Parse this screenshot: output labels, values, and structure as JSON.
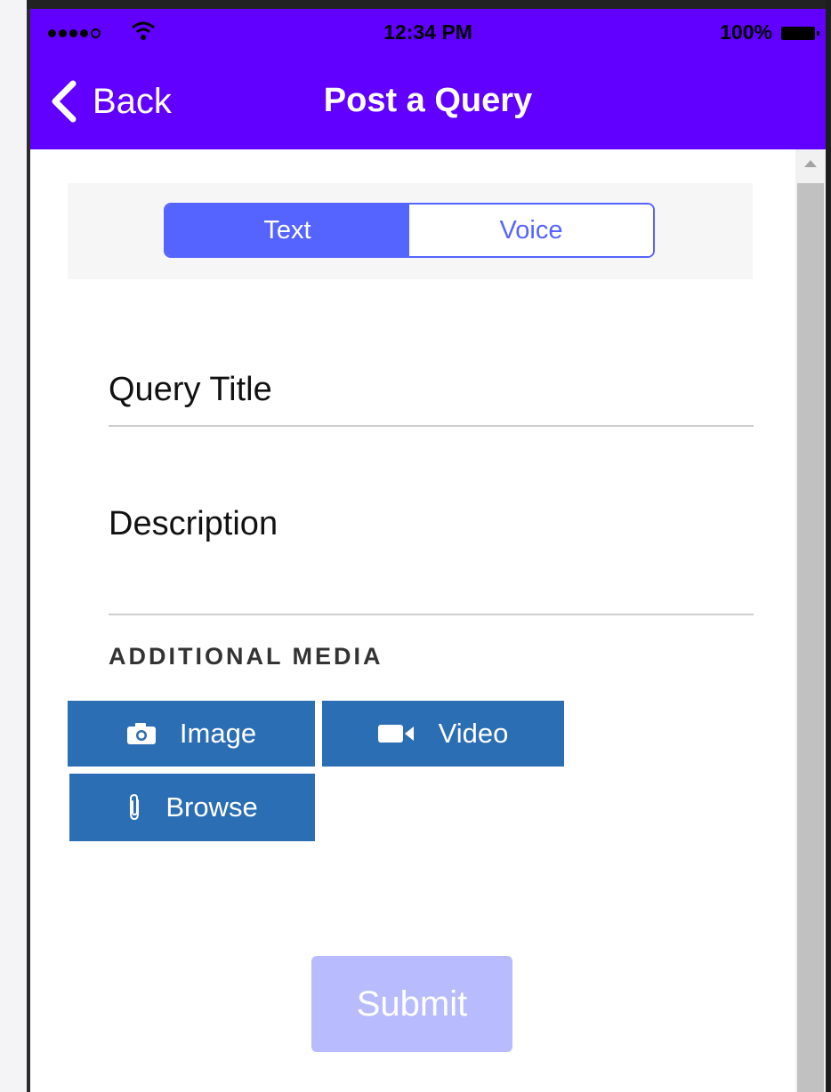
{
  "status_bar": {
    "time": "12:34 PM",
    "battery": "100%"
  },
  "nav": {
    "back_label": "Back",
    "title": "Post a Query"
  },
  "segmented": {
    "options": [
      "Text",
      "Voice"
    ],
    "selected": "Text"
  },
  "form": {
    "title_placeholder": "Query Title",
    "description_placeholder": "Description"
  },
  "media": {
    "heading": "ADDITIONAL MEDIA",
    "image_label": "Image",
    "video_label": "Video",
    "browse_label": "Browse"
  },
  "submit_label": "Submit",
  "colors": {
    "nav_bg": "#6100ff",
    "segment_accent": "#5664ff",
    "media_button": "#2b6eb4",
    "submit_disabled": "#b8bcff"
  },
  "icons": {
    "back": "chevron-left-icon",
    "image": "camera-icon",
    "video": "video-camera-icon",
    "browse": "paperclip-icon"
  }
}
